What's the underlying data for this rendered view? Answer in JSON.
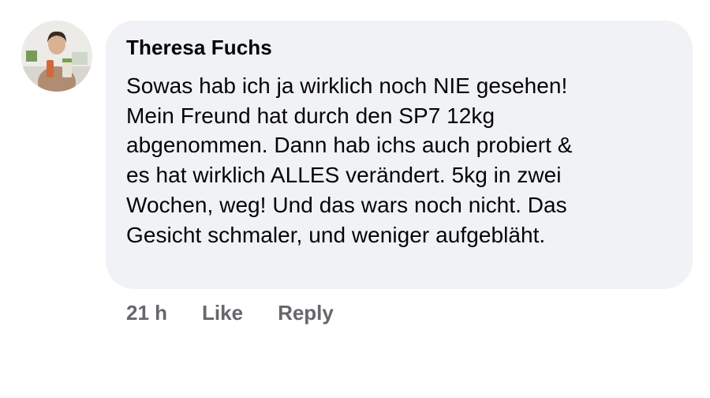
{
  "comment": {
    "author": "Theresa Fuchs",
    "text": "Sowas hab ich ja wirklich noch NIE gesehen!\nMein Freund hat durch den SP7 12kg\nabgenommen. Dann hab ichs auch probiert &\nes hat wirklich ALLES verändert. 5kg in zwei\nWochen, weg! Und das wars noch nicht. Das\nGesicht schmaler, und weniger aufgebläht.",
    "timestamp": "21 h",
    "like_label": "Like",
    "reply_label": "Reply"
  },
  "colors": {
    "bubble_bg": "#f0f2f5",
    "text": "#050505",
    "secondary_text": "#65676b"
  }
}
